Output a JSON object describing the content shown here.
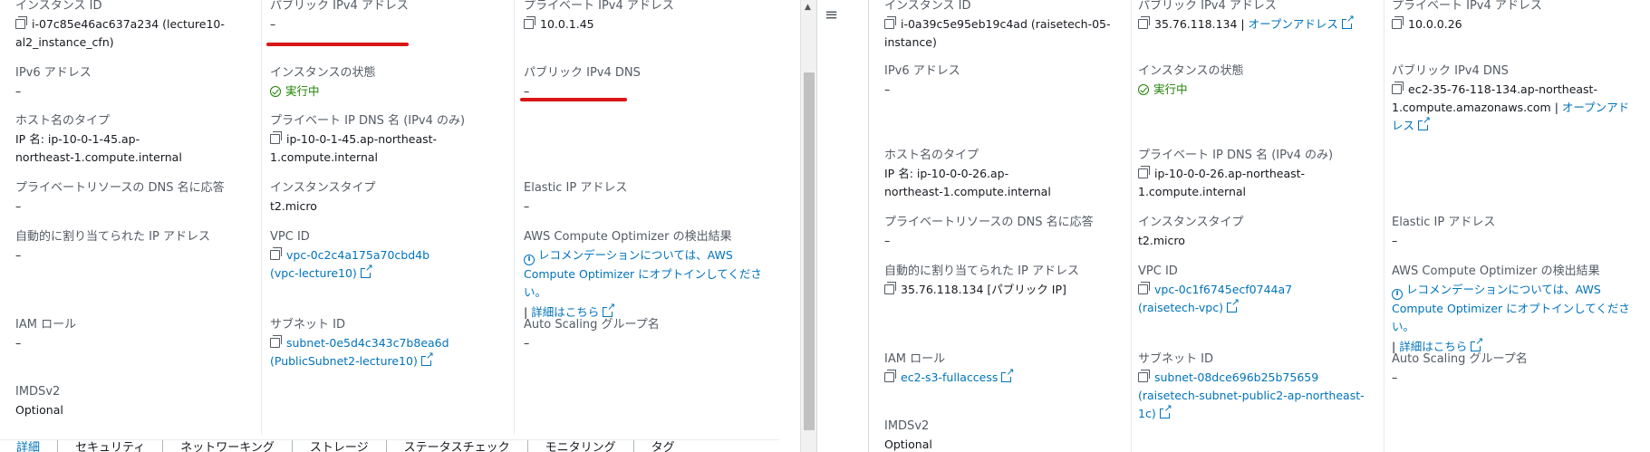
{
  "left": {
    "instance_id_label": "インスタンス ID",
    "instance_id_value": "i-07c85e46ac637a234 (lecture10-al2_instance_cfn)",
    "public_ipv4_label": "パブリック IPv4 アドレス",
    "public_ipv4_value": "–",
    "private_ipv4_label": "プライベート IPv4 アドレス",
    "private_ipv4_value": "10.0.1.45",
    "ipv6_label": "IPv6 アドレス",
    "ipv6_value": "–",
    "state_label": "インスタンスの状態",
    "state_value": "実行中",
    "public_dns_label": "パブリック IPv4 DNS",
    "public_dns_value": "–",
    "hostname_type_label": "ホスト名のタイプ",
    "hostname_type_value": "IP 名: ip-10-0-1-45.ap-northeast-1.compute.internal",
    "private_dns_label": "プライベート IP DNS 名 (IPv4 のみ)",
    "private_dns_value": "ip-10-0-1-45.ap-northeast-1.compute.internal",
    "resource_dns_label": "プライベートリソースの DNS 名に応答",
    "resource_dns_value": "–",
    "instance_type_label": "インスタンスタイプ",
    "instance_type_value": "t2.micro",
    "elastic_ip_label": "Elastic IP アドレス",
    "elastic_ip_value": "–",
    "auto_ip_label": "自動的に割り当てられた IP アドレス",
    "auto_ip_value": "–",
    "vpc_label": "VPC ID",
    "vpc_value": "vpc-0c2c4a175a70cbd4b (vpc-lecture10)",
    "optimizer_label": "AWS Compute Optimizer の検出結果",
    "optimizer_text": "レコメンデーションについては、AWS Compute Optimizer にオプトインしてください。",
    "optimizer_more": "詳細はこちら",
    "iam_label": "IAM ロール",
    "iam_value": "–",
    "subnet_label": "サブネット ID",
    "subnet_value": "subnet-0e5d4c343c7b8ea6d (PublicSubnet2-lecture10)",
    "asg_label": "Auto Scaling グループ名",
    "asg_value": "–",
    "imds_label": "IMDSv2",
    "imds_value": "Optional"
  },
  "tabs": [
    "詳細",
    "セキュリティ",
    "ネットワーキング",
    "ストレージ",
    "ステータスチェック",
    "モニタリング",
    "タグ"
  ],
  "right": {
    "instance_id_label": "インスタンス ID",
    "instance_id_value": "i-0a39c5e95eb19c4ad (raisetech-05-instance)",
    "public_ipv4_label": "パブリック IPv4 アドレス",
    "public_ipv4_value": "35.76.118.134",
    "open_address": "オープンアドレス",
    "private_ipv4_label": "プライベート IPv4 アドレス",
    "private_ipv4_value": "10.0.0.26",
    "ipv6_label": "IPv6 アドレス",
    "ipv6_value": "–",
    "state_label": "インスタンスの状態",
    "state_value": "実行中",
    "public_dns_label": "パブリック IPv4 DNS",
    "public_dns_value": "ec2-35-76-118-134.ap-northeast-1.compute.amazonaws.com",
    "hostname_type_label": "ホスト名のタイプ",
    "hostname_type_value": "IP 名: ip-10-0-0-26.ap-northeast-1.compute.internal",
    "private_dns_label": "プライベート IP DNS 名 (IPv4 のみ)",
    "private_dns_value": "ip-10-0-0-26.ap-northeast-1.compute.internal",
    "resource_dns_label": "プライベートリソースの DNS 名に応答",
    "resource_dns_value": "–",
    "instance_type_label": "インスタンスタイプ",
    "instance_type_value": "t2.micro",
    "elastic_ip_label": "Elastic IP アドレス",
    "elastic_ip_value": "–",
    "auto_ip_label": "自動的に割り当てられた IP アドレス",
    "auto_ip_value": "35.76.118.134 [パブリック IP]",
    "vpc_label": "VPC ID",
    "vpc_value": "vpc-0c1f6745ecf0744a7 (raisetech-vpc)",
    "optimizer_label": "AWS Compute Optimizer の検出結果",
    "optimizer_text": "レコメンデーションについては、AWS Compute Optimizer にオプトインしてください。",
    "optimizer_more": "詳細はこちら",
    "iam_label": "IAM ロール",
    "iam_value": "ec2-s3-fullaccess",
    "subnet_label": "サブネット ID",
    "subnet_value": "subnet-08dce696b25b75659 (raisetech-subnet-public2-ap-northeast-1c)",
    "asg_label": "Auto Scaling グループ名",
    "asg_value": "–",
    "imds_label": "IMDSv2",
    "imds_value": "Optional"
  },
  "colors": {
    "link": "#0073bb",
    "running": "#1d8102",
    "annotation": "#d91515"
  },
  "icons": [
    "copy-icon",
    "external-link-icon",
    "check-circle-icon",
    "info-icon",
    "hamburger-icon"
  ]
}
